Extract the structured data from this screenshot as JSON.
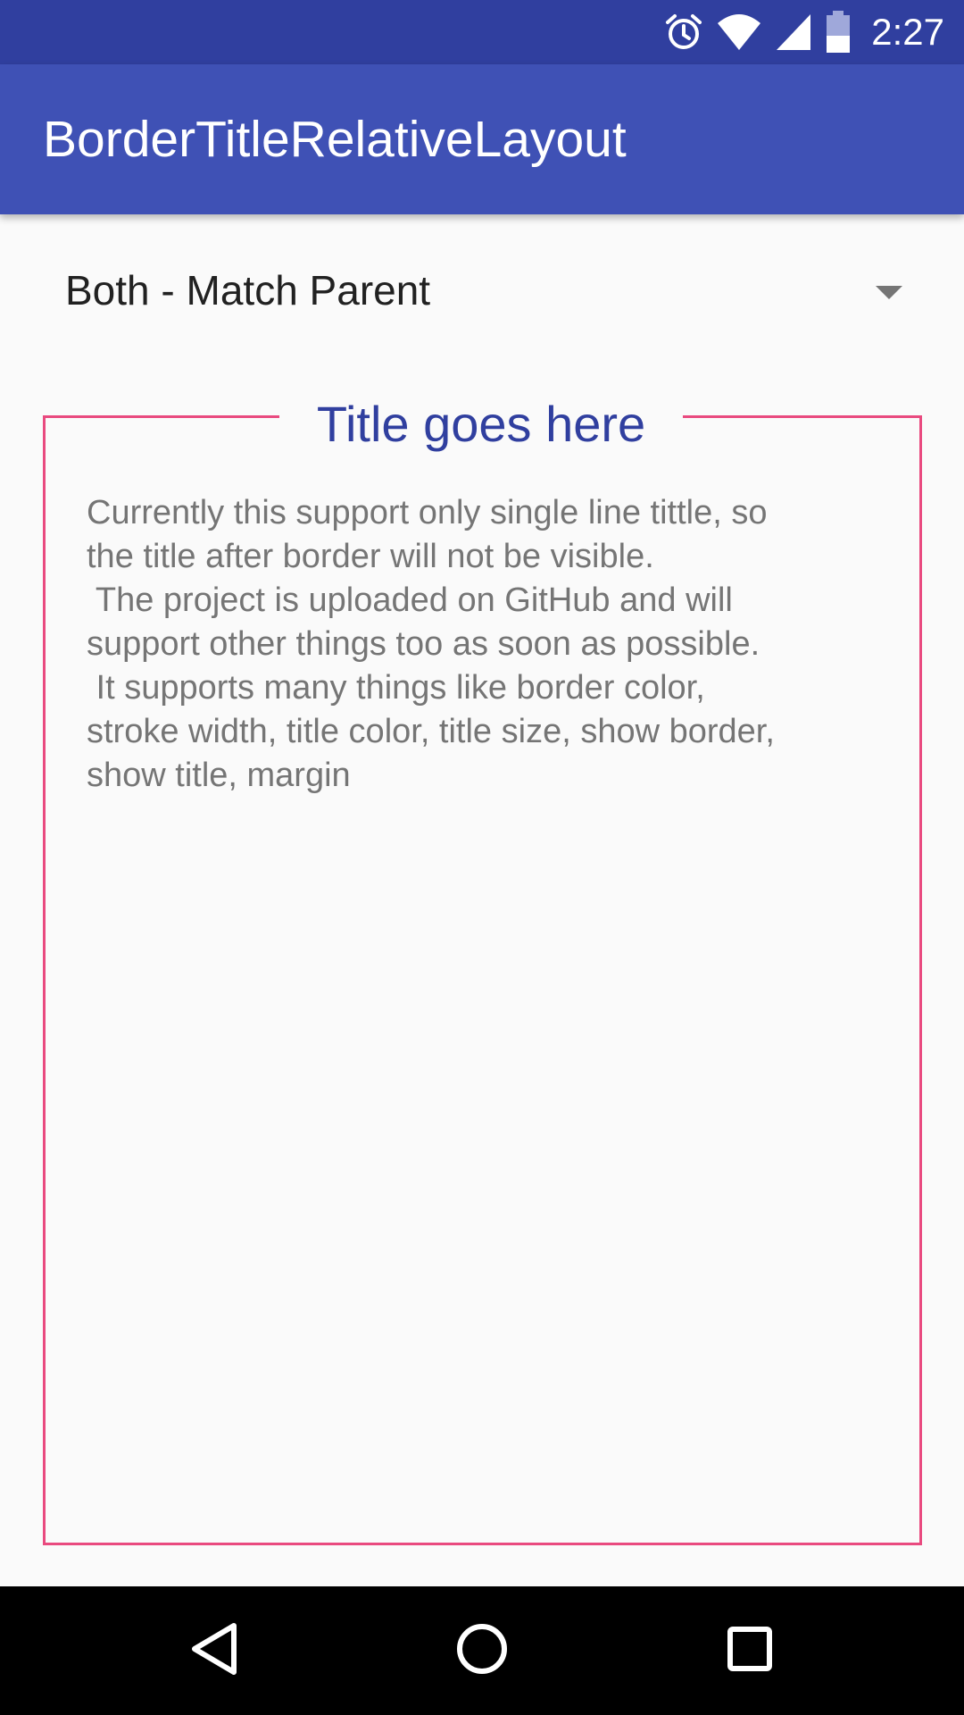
{
  "status_bar": {
    "time": "2:27",
    "icons": [
      "alarm-icon",
      "wifi-icon",
      "cell-signal-icon",
      "battery-icon"
    ]
  },
  "app_bar": {
    "title": "BorderTitleRelativeLayout"
  },
  "spinner": {
    "selected_value": "Both - Match Parent"
  },
  "bordered_layout": {
    "title": "Title goes here",
    "body_lines": [
      "Currently this support only single line tittle, so",
      "the title after border will not be visible.",
      " The project is uploaded on GitHub and will",
      "support other things too as soon as possible.",
      " It supports many things like border color,",
      "stroke width, title color, title size, show border,",
      "show title, margin"
    ],
    "border_color": "#e94a7f",
    "title_color": "#303f9f"
  },
  "nav_bar": {
    "buttons": [
      "back-icon",
      "home-icon",
      "recents-icon"
    ]
  },
  "colors": {
    "primary": "#3f51b5",
    "primary_dark": "#303f9f",
    "accent": "#e94a7f"
  }
}
